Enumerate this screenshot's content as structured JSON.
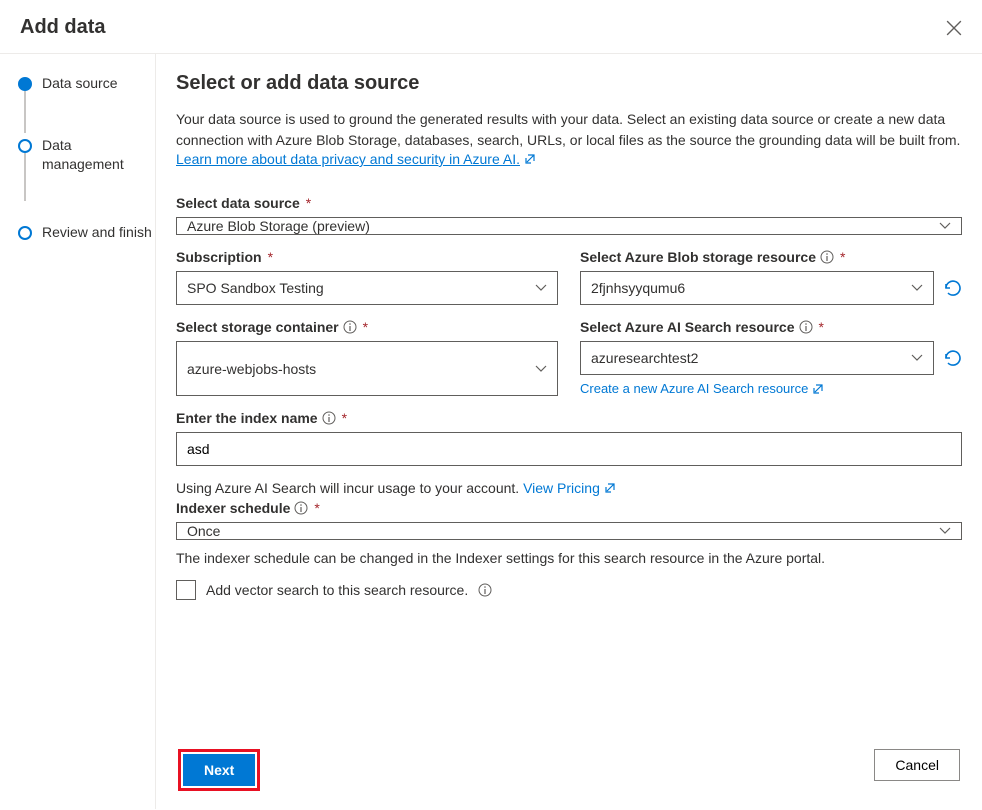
{
  "header": {
    "title": "Add data"
  },
  "steps": [
    {
      "label": "Data source",
      "active": true
    },
    {
      "label": "Data management",
      "active": false
    },
    {
      "label": "Review and finish",
      "active": false
    }
  ],
  "main": {
    "title": "Select or add data source",
    "desc1": "Your data source is used to ground the generated results with your data. Select an existing data source or create a new data connection with Azure Blob Storage, databases, search, URLs, or local files as the source the grounding data will be built from. ",
    "learn_link": "Learn more about data privacy and security in Azure AI.",
    "labels": {
      "data_source": "Select data source",
      "subscription": "Subscription",
      "blob_resource": "Select Azure Blob storage resource",
      "storage_container": "Select storage container",
      "search_resource": "Select Azure AI Search resource",
      "index_name": "Enter the index name",
      "indexer_schedule": "Indexer schedule"
    },
    "values": {
      "data_source": "Azure Blob Storage (preview)",
      "subscription": "SPO Sandbox Testing",
      "blob_resource": "2fjnhsyyqumu6",
      "storage_container": "azure-webjobs-hosts",
      "search_resource": "azuresearchtest2",
      "index_name": "asd",
      "indexer_schedule": "Once"
    },
    "create_search_link": "Create a new Azure AI Search resource",
    "pricing_text": "Using Azure AI Search will incur usage to your account. ",
    "pricing_link": "View Pricing",
    "indexer_note": "The indexer schedule can be changed in the Indexer settings for this search resource in the Azure portal.",
    "vector_label": "Add vector search to this search resource."
  },
  "footer": {
    "next": "Next",
    "cancel": "Cancel"
  }
}
